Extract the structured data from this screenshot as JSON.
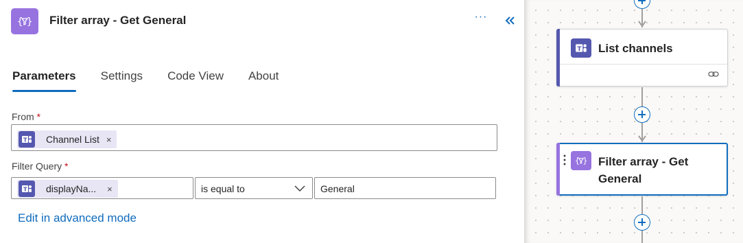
{
  "panel": {
    "title": "Filter array - Get General",
    "more_label": "···",
    "tabs": [
      {
        "label": "Parameters",
        "active": true
      },
      {
        "label": "Settings",
        "active": false
      },
      {
        "label": "Code View",
        "active": false
      },
      {
        "label": "About",
        "active": false
      }
    ],
    "from": {
      "label": "From",
      "required_mark": "*",
      "token": {
        "label": "Channel List",
        "remove": "×",
        "icon": "teams-icon"
      }
    },
    "filter_query": {
      "label": "Filter Query",
      "required_mark": "*",
      "left_token": {
        "label": "displayNa...",
        "remove": "×",
        "icon": "teams-icon"
      },
      "operator": "is equal to",
      "value": "General"
    },
    "advanced_link": "Edit in advanced mode"
  },
  "canvas": {
    "cards": [
      {
        "title": "List channels",
        "icon": "teams-icon",
        "accent": "#5558af",
        "footer_icon": "link-icon"
      },
      {
        "title_line1": "Filter array - Get",
        "title_line2": "General",
        "icon": "filter-array-icon",
        "accent": "#9773e0",
        "selected": true
      }
    ]
  },
  "colors": {
    "accent": "#0f6cbd",
    "teams": "#5558af",
    "data_operation": "#9773e0",
    "required": "#c50f1f"
  }
}
